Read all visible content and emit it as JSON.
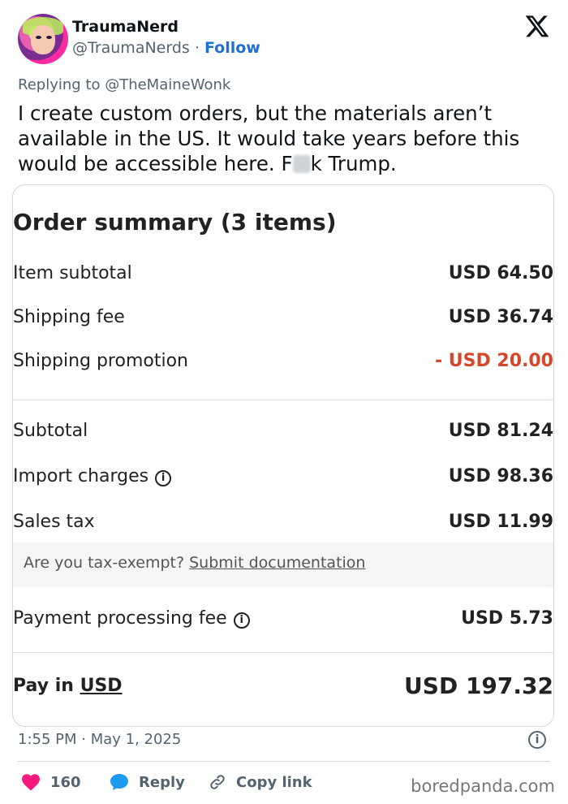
{
  "author": {
    "name": "TraumaNerd",
    "handle": "@TraumaNerds",
    "separator": "·",
    "follow_label": "Follow"
  },
  "tweet": {
    "replying_to": "Replying to @TheMaineWonk",
    "text_part1": "I create custom orders, but the materials aren’t available in the US. It would take years before this would be accessible here. F",
    "text_part2": "k Trump.",
    "timestamp": "1:55 PM · May 1, 2025"
  },
  "order": {
    "title": "Order summary (3 items)",
    "rows": [
      {
        "label": "Item subtotal",
        "value": "USD 64.50"
      },
      {
        "label": "Shipping fee",
        "value": "USD 36.74"
      },
      {
        "label": "Shipping promotion",
        "value": "- USD 20.00"
      },
      {
        "label": "Subtotal",
        "value": "USD 81.24"
      },
      {
        "label": "Import charges",
        "value": "USD 98.36"
      },
      {
        "label": "Sales tax",
        "value": "USD 11.99"
      },
      {
        "label": "Payment processing fee",
        "value": "USD 5.73"
      }
    ],
    "tax_question": "Are you tax-exempt? ",
    "tax_link": "Submit documentation",
    "pay_prefix": "Pay in ",
    "pay_currency": "USD",
    "pay_total": "USD 197.32"
  },
  "actions": {
    "likes": "160",
    "reply_label": "Reply",
    "copy_label": "Copy link"
  },
  "watermark": "boredpanda.com",
  "colors": {
    "follow_blue": "#1d70d4",
    "promo_red": "#d5472a",
    "heart_pink": "#f91880",
    "reply_blue": "#1d9bf0"
  },
  "icons": [
    "x-logo-icon",
    "info-icon",
    "heart-icon",
    "reply-bubble-icon",
    "link-icon"
  ]
}
